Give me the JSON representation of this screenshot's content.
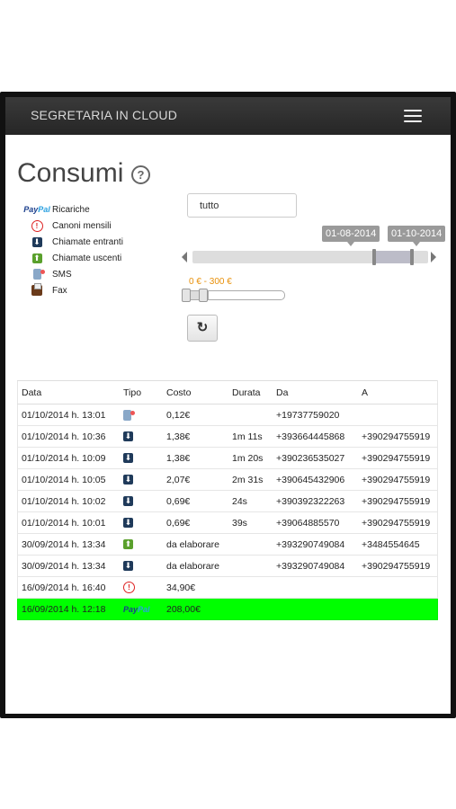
{
  "app": {
    "brand": "SEGRETARIA IN CLOUD"
  },
  "page": {
    "title": "Consumi",
    "help_glyph": "?"
  },
  "legend": [
    {
      "icon": "paypal-icon",
      "label": "Ricariche"
    },
    {
      "icon": "alert-icon",
      "label": "Canoni mensili"
    },
    {
      "icon": "incoming-call-icon",
      "label": "Chiamate entranti"
    },
    {
      "icon": "outgoing-call-icon",
      "label": "Chiamate uscenti"
    },
    {
      "icon": "sms-icon",
      "label": "SMS"
    },
    {
      "icon": "fax-icon",
      "label": "Fax"
    }
  ],
  "filters": {
    "type_select": "tutto",
    "date_from": "01-08-2014",
    "date_to": "01-10-2014",
    "price_range": "0 € - 300 €",
    "refresh_glyph": "↻"
  },
  "paypal_logo": {
    "part1": "Pay",
    "part2": "Pal"
  },
  "table": {
    "headers": [
      "Data",
      "Tipo",
      "Costo",
      "Durata",
      "Da",
      "A"
    ],
    "rows": [
      {
        "data": "01/10/2014 h. 13:01",
        "tipo": "sms",
        "costo": "0,12€",
        "durata": "",
        "da": "+19737759020",
        "a": ""
      },
      {
        "data": "01/10/2014 h. 10:36",
        "tipo": "incoming",
        "costo": "1,38€",
        "durata": "1m 11s",
        "da": "+393664445868",
        "a": "+390294755919"
      },
      {
        "data": "01/10/2014 h. 10:09",
        "tipo": "incoming",
        "costo": "1,38€",
        "durata": "1m 20s",
        "da": "+390236535027",
        "a": "+390294755919"
      },
      {
        "data": "01/10/2014 h. 10:05",
        "tipo": "incoming",
        "costo": "2,07€",
        "durata": "2m 31s",
        "da": "+390645432906",
        "a": "+390294755919"
      },
      {
        "data": "01/10/2014 h. 10:02",
        "tipo": "incoming",
        "costo": "0,69€",
        "durata": "24s",
        "da": "+390392322263",
        "a": "+390294755919"
      },
      {
        "data": "01/10/2014 h. 10:01",
        "tipo": "incoming",
        "costo": "0,69€",
        "durata": "39s",
        "da": "+39064885570",
        "a": "+390294755919"
      },
      {
        "data": "30/09/2014 h. 13:34",
        "tipo": "outgoing",
        "costo": "da elaborare",
        "durata": "",
        "da": "+393290749084",
        "a": "+3484554645"
      },
      {
        "data": "30/09/2014 h. 13:34",
        "tipo": "incoming",
        "costo": "da elaborare",
        "durata": "",
        "da": "+393290749084",
        "a": "+390294755919"
      },
      {
        "data": "16/09/2014 h. 16:40",
        "tipo": "canone",
        "costo": "34,90€",
        "durata": "",
        "da": "",
        "a": ""
      },
      {
        "data": "16/09/2014 h. 12:18",
        "tipo": "paypal",
        "costo": "208,00€",
        "durata": "",
        "da": "",
        "a": ""
      }
    ]
  },
  "colors": {
    "navbar": "#2e2e2e",
    "highlight_row": "#00ff00",
    "price_label": "#e8900a"
  }
}
